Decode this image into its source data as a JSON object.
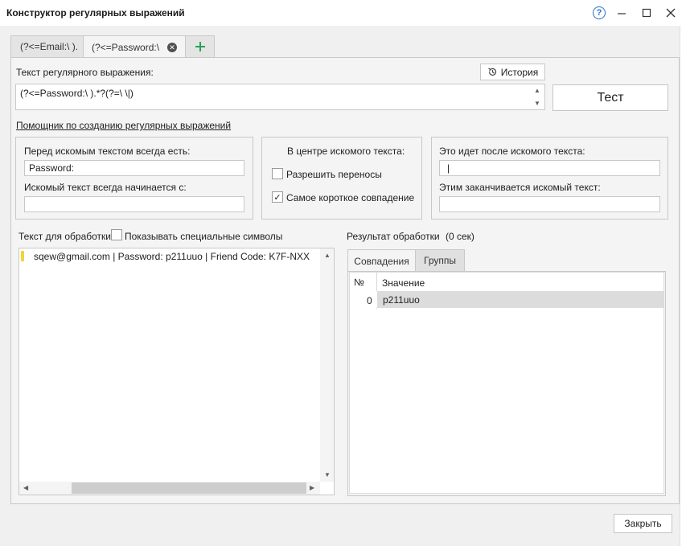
{
  "window": {
    "title": "Конструктор регулярных выражений",
    "help_glyph": "?"
  },
  "tabs": [
    {
      "label": "(?<=Email:\\ )."
    },
    {
      "label": "(?<=Password:\\"
    }
  ],
  "regex": {
    "label": "Текст регулярного выражения:",
    "value": "(?<=Password:\\ ).*?(?=\\ \\|)",
    "history_label": "История",
    "test_label": "Тест"
  },
  "helper_link": "Помощник по созданию регулярных выражений",
  "before": {
    "label": "Перед искомым текстом всегда есть:",
    "value": "Password:",
    "starts_label": "Искомый текст всегда начинается с:",
    "starts_value": ""
  },
  "center": {
    "label": "В центре искомого текста:",
    "allow_wraps": "Разрешить переносы",
    "allow_wraps_checked": false,
    "shortest": "Самое короткое совпадение",
    "shortest_checked": true
  },
  "after": {
    "label": "Это идет после искомого текста:",
    "value": "|",
    "ends_label": "Этим заканчивается искомый текст:",
    "ends_value": ""
  },
  "source": {
    "label": "Текст для обработки",
    "show_special": "Показывать специальные символы",
    "show_special_checked": false,
    "text": "sqew@gmail.com | Password: p211uuo | Friend Code: K7F-NXX"
  },
  "result": {
    "label": "Результат обработки",
    "time": "(0 сек)",
    "tabs": [
      "Совпадения",
      "Группы"
    ],
    "columns": [
      "№",
      "Значение"
    ],
    "rows": [
      {
        "num": "0",
        "value": "p211uuo"
      }
    ]
  },
  "close_label": "Закрыть",
  "colors": {
    "accent": "#2a6fc9",
    "plus": "#2aa055",
    "marker": "#f4d33c",
    "selected_row": "#dcdcdc"
  }
}
